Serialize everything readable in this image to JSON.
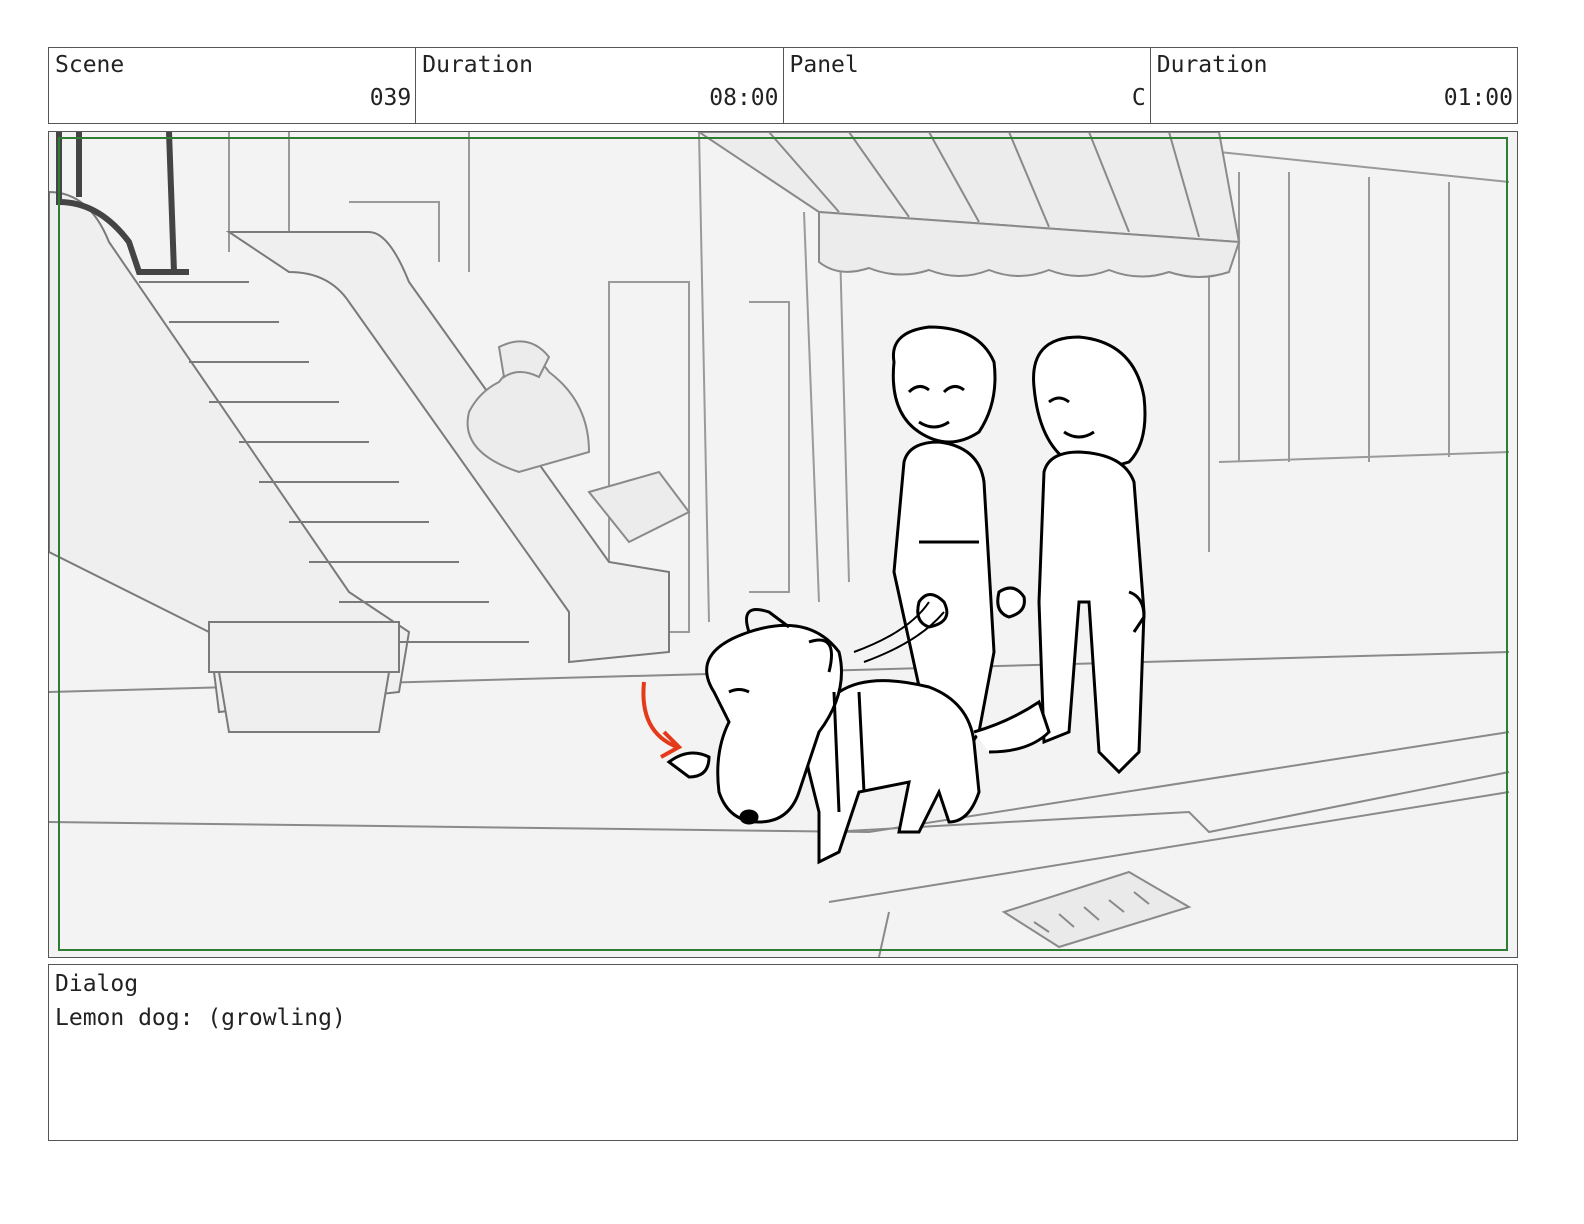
{
  "header": {
    "scene_label": "Scene",
    "scene_value": "039",
    "scene_duration_label": "Duration",
    "scene_duration_value": "08:00",
    "panel_label": "Panel",
    "panel_value": "C",
    "panel_duration_label": "Duration",
    "panel_duration_value": "01:00"
  },
  "frame_color": "#2e7d32",
  "arrow_color": "#e53a1a",
  "dialog": {
    "label": "Dialog",
    "text": "Lemon dog: (growling)"
  }
}
